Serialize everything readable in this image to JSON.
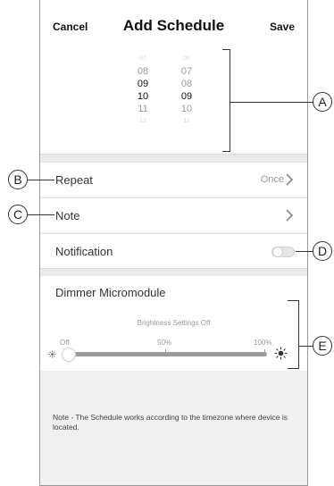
{
  "header": {
    "cancel_label": "Cancel",
    "title": "Add Schedule",
    "save_label": "Save"
  },
  "time_picker": {
    "hours": [
      {
        "text": "07",
        "style": "faint"
      },
      {
        "text": "08",
        "style": "dim"
      },
      {
        "text": "09",
        "style": "selected"
      },
      {
        "text": "10",
        "style": "selected"
      },
      {
        "text": "11",
        "style": "dim"
      },
      {
        "text": "12",
        "style": "faint"
      }
    ],
    "minutes": [
      {
        "text": "06",
        "style": "faint"
      },
      {
        "text": "07",
        "style": "dim"
      },
      {
        "text": "08",
        "style": "dim"
      },
      {
        "text": "09",
        "style": "selected"
      },
      {
        "text": "10",
        "style": "dim"
      },
      {
        "text": "11",
        "style": "faint"
      }
    ]
  },
  "settings": {
    "repeat": {
      "label": "Repeat",
      "value": "Once"
    },
    "note": {
      "label": "Note"
    },
    "notification": {
      "label": "Notification",
      "enabled": false
    }
  },
  "dimmer": {
    "title": "Dimmer Micromodule",
    "subtitle": "Brightness Settings Off",
    "ticks": [
      "Off",
      "50%",
      "100%"
    ],
    "level_percent": 0
  },
  "footer_note": "Note - The Schedule works according to the timezone where device is located.",
  "callouts": {
    "a": "A",
    "b": "B",
    "c": "C",
    "d": "D",
    "e": "E"
  },
  "icons": {
    "chevron": "chevron-right-icon",
    "sun_small": "brightness-low-icon",
    "sun_large": "brightness-high-icon"
  }
}
